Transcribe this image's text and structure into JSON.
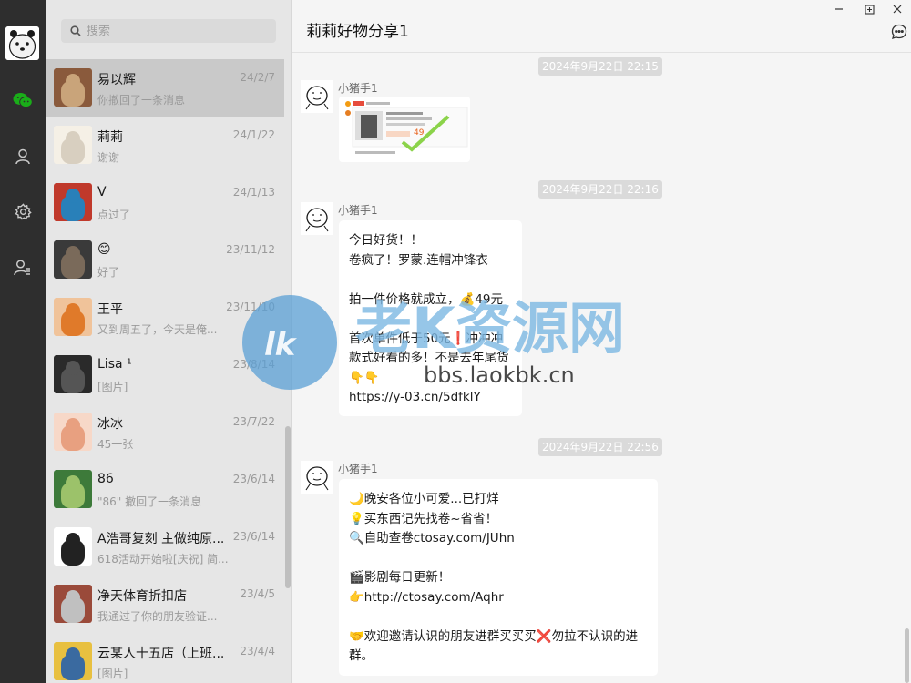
{
  "app": {
    "name": "WeChat"
  },
  "rail": {
    "icons": [
      "chat-icon",
      "contacts-icon",
      "settings-icon",
      "profile-icon"
    ],
    "accent": "#1aad19"
  },
  "search": {
    "placeholder": "搜索"
  },
  "conversations": [
    {
      "name": "易以辉",
      "time": "24/2/7",
      "preview": "你撤回了一条消息",
      "active": true
    },
    {
      "name": "莉莉",
      "time": "24/1/22",
      "preview": "谢谢"
    },
    {
      "name": "V",
      "time": "24/1/13",
      "preview": "点过了"
    },
    {
      "name": "😊",
      "time": "23/11/12",
      "preview": "好了"
    },
    {
      "name": "王平",
      "time": "23/11/10",
      "preview": "又到周五了，今天是俺..."
    },
    {
      "name": "Lisa ¹",
      "time": "23/8/14",
      "preview": "[图片]"
    },
    {
      "name": "冰冰",
      "time": "23/7/22",
      "preview": "45一张"
    },
    {
      "name": "86",
      "time": "23/6/14",
      "preview": "\"86\" 撤回了一条消息"
    },
    {
      "name": "A浩哥复刻 主做纯原...",
      "time": "23/6/14",
      "preview": "618活动开始啦[庆祝] 简..."
    },
    {
      "name": "净天体育折扣店",
      "time": "23/4/5",
      "preview": "我通过了你的朋友验证..."
    },
    {
      "name": "云某人十五店（上班...",
      "time": "23/4/4",
      "preview": "[图片]"
    }
  ],
  "chat": {
    "title": "莉莉好物分享1",
    "window_controls": [
      "minimize-icon",
      "maximize-icon",
      "close-icon"
    ],
    "messages": [
      {
        "timestamp": "2024年9月22日 22:15",
        "sender": "小猪手1",
        "type": "image",
        "card": {
          "shop": "淘宝",
          "price": "49"
        }
      },
      {
        "timestamp": "2024年9月22日 22:16",
        "sender": "小猪手1",
        "type": "text",
        "lines": [
          "今日好货！！",
          "卷疯了！罗蒙.连帽冲锋衣",
          "",
          "拍一件价格就成立，💰49元",
          "",
          "首次单件低于50元❗冲冲冲",
          "款式好看的多！不是去年尾货",
          "👇👇",
          "https://y-03.cn/5dfklY"
        ]
      },
      {
        "timestamp": "2024年9月22日 22:56",
        "sender": "小猪手1",
        "type": "text",
        "lines": [
          "🌙晚安各位小可爱...已打烊",
          "💡买东西记先找卷~省省！",
          "🔍自助查卷ctosay.com/JUhn",
          "",
          "🎬影剧每日更新！",
          "👉http://ctosay.com/Aqhr",
          "",
          "🤝欢迎邀请认识的朋友进群买买买❌勿拉不认识的进",
          "群。"
        ]
      }
    ]
  },
  "watermark": {
    "brand": "老K资源网",
    "url": "bbs.laokbk.cn"
  }
}
